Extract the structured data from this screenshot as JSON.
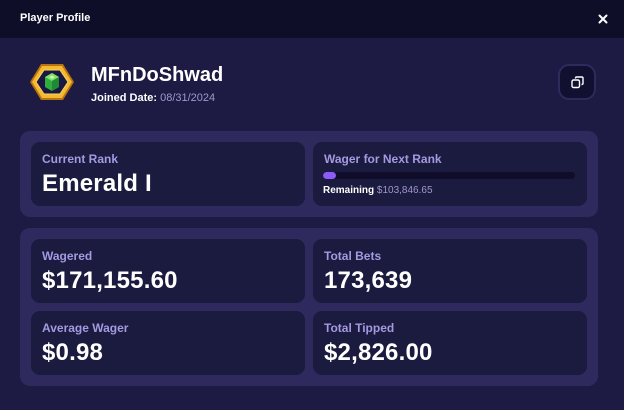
{
  "header": {
    "title": "Player Profile"
  },
  "profile": {
    "username": "MFnDoShwad",
    "joined_label": "Joined Date:",
    "joined_date": "08/31/2024"
  },
  "rank": {
    "current_label": "Current Rank",
    "current_value": "Emerald I",
    "next_label": "Wager for Next Rank",
    "progress_fraction": 0.05,
    "remaining_label": "Remaining",
    "remaining_value": "$103,846.65"
  },
  "stats": [
    {
      "label": "Wagered",
      "value": "$171,155.60"
    },
    {
      "label": "Total Bets",
      "value": "173,639"
    },
    {
      "label": "Average Wager",
      "value": "$0.98"
    },
    {
      "label": "Total Tipped",
      "value": "$2,826.00"
    }
  ],
  "colors": {
    "background": "#1d1b43",
    "header_bg": "#0f0e28",
    "panel_bg": "#2e2a5e",
    "card_bg": "#1b1a3f",
    "label": "#a39ae0",
    "accent": "#8b5cf6"
  },
  "icons": {
    "close": "close-icon",
    "copy": "copy-icon",
    "avatar": "emerald-rank-badge-icon"
  }
}
